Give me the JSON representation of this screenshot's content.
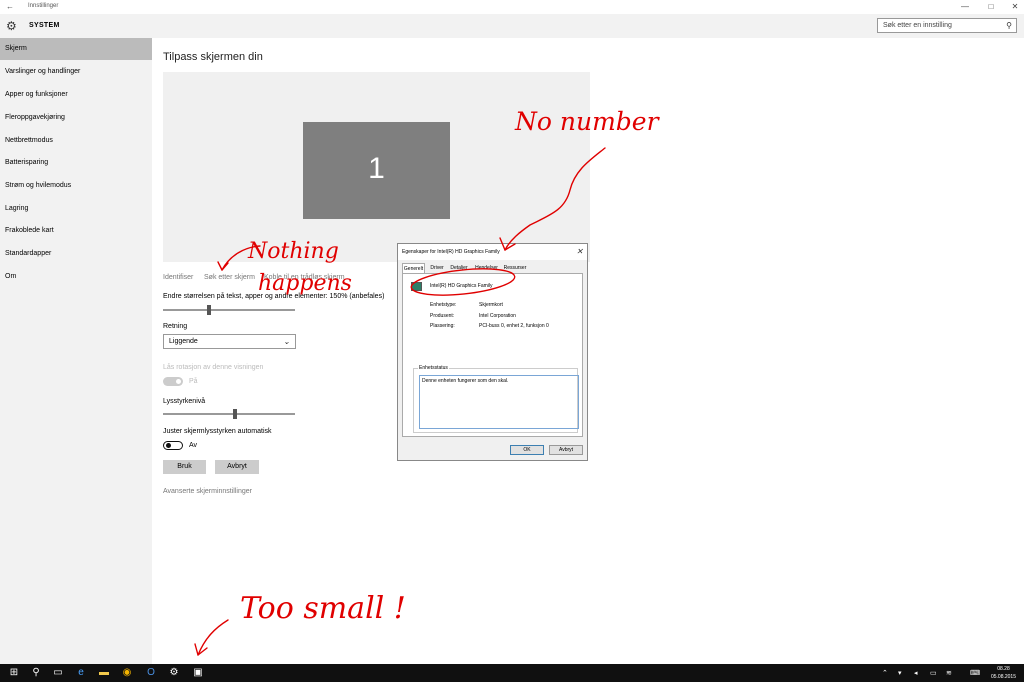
{
  "window": {
    "title": "Innstillinger",
    "back_icon": "←",
    "minimize_icon": "—",
    "maximize_icon": "□",
    "close_icon": "✕"
  },
  "header": {
    "section_title": "SYSTEM",
    "search_placeholder": "Søk etter en innstilling"
  },
  "sidebar": {
    "items": [
      {
        "label": "Skjerm",
        "active": true
      },
      {
        "label": "Varslinger og handlinger"
      },
      {
        "label": "Apper og funksjoner"
      },
      {
        "label": "Fleroppgavekjøring"
      },
      {
        "label": "Nettbrettmodus"
      },
      {
        "label": "Batterisparing"
      },
      {
        "label": "Strøm og hvilemodus"
      },
      {
        "label": "Lagring"
      },
      {
        "label": "Frakoblede kart"
      },
      {
        "label": "Standardapper"
      },
      {
        "label": "Om"
      }
    ]
  },
  "main": {
    "title": "Tilpass skjermen din",
    "monitor_number": "1",
    "links": {
      "identify": "Identifiser",
      "detect": "Søk etter skjerm",
      "connect": "Koble til en trådløs skjerm"
    },
    "scale_label": "Endre størrelsen på tekst, apper og andre elementer: 150% (anbefales)",
    "scale_percent": 150,
    "orientation_label": "Retning",
    "orientation_value": "Liggende",
    "rotation_lock_label": "Lås rotasjon av denne visningen",
    "rotation_lock_state": "På",
    "brightness_label": "Lysstyrkenivå",
    "brightness_fraction": 0.53,
    "auto_brightness_label": "Juster skjermlysstyrken automatisk",
    "auto_brightness_state": "Av",
    "apply_button": "Bruk",
    "cancel_button": "Avbryt",
    "advanced_link": "Avanserte skjerminnstillinger"
  },
  "dialog": {
    "title": "Egenskaper for Intel(R) HD Graphics Family",
    "tabs": [
      "Generelt",
      "Driver",
      "Detaljer",
      "Hendelser",
      "Ressurser"
    ],
    "active_tab": "Generelt",
    "device_name": "Intel(R) HD Graphics Family",
    "properties": [
      {
        "key": "Enhetstype:",
        "value": "Skjermkort"
      },
      {
        "key": "Produsent:",
        "value": "Intel Corporation"
      },
      {
        "key": "Plassering:",
        "value": "PCI-buss 0, enhet 2, funksjon 0"
      }
    ],
    "status_group": "Enhetsstatus",
    "status_text": "Denne enheten fungerer som den skal.",
    "ok_button": "OK",
    "cancel_button": "Avbryt"
  },
  "annotations": {
    "no_number": "No number",
    "nothing": "Nothing",
    "happens": "happens",
    "too_small": "Too small !",
    "color": "#e00000"
  },
  "taskbar": {
    "time": "08.28",
    "date": "05.08.2015",
    "start_icon": "⊞",
    "search_icon": "⚲",
    "taskview_icon": "▭",
    "edge_icon": "e",
    "explorer_icon": "▬",
    "chrome_icon": "◉",
    "outlook_icon": "O",
    "settings_icon": "⚙",
    "devmgr_icon": "▣"
  }
}
